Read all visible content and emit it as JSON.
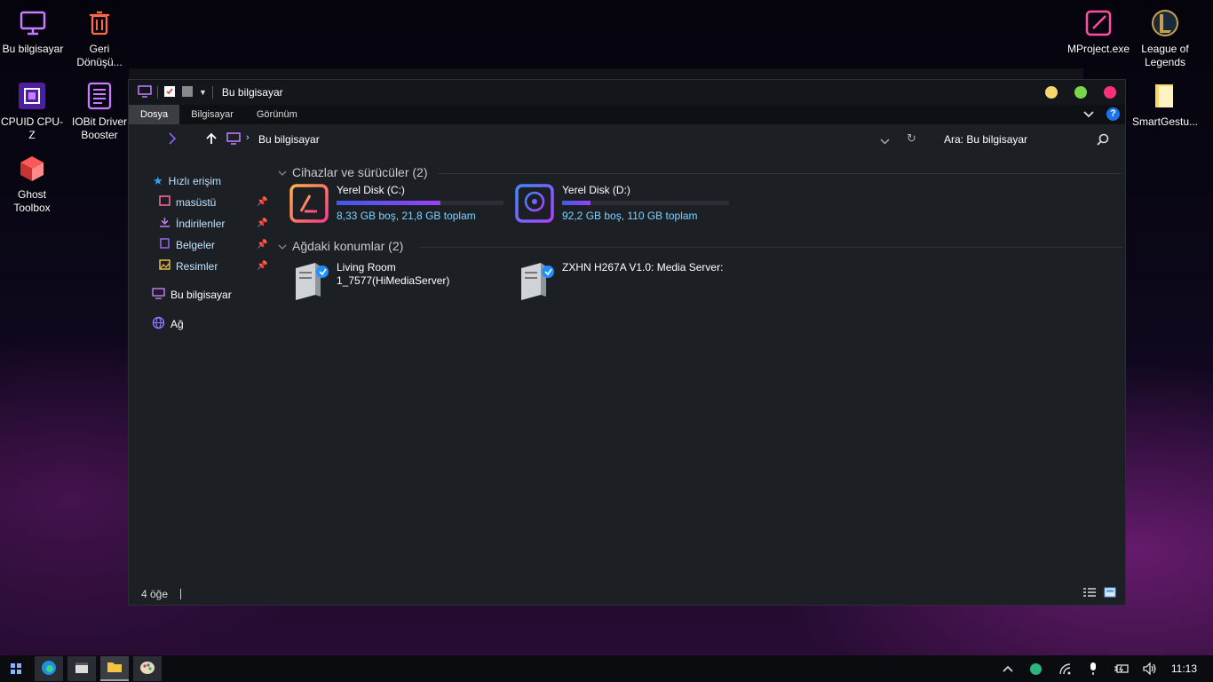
{
  "desktop": {
    "icons_left": [
      {
        "label": "Bu bilgisayar"
      },
      {
        "label": "Geri Dönüşü..."
      },
      {
        "label": "CPUID CPU-Z"
      },
      {
        "label": "IOBit Driver Booster"
      },
      {
        "label": "Ghost Toolbox"
      }
    ],
    "icons_right": [
      {
        "label": "MProject.exe"
      },
      {
        "label": "League of Legends"
      },
      {
        "label": "SmartGestu..."
      }
    ]
  },
  "window": {
    "title": "Bu bilgisayar",
    "controls_colors": {
      "minimize": "#f5d76e",
      "maximize": "#7bd64b",
      "close": "#ff2f7a"
    }
  },
  "ribbon": {
    "tabs": [
      {
        "label": "Dosya",
        "active": true
      },
      {
        "label": "Bilgisayar",
        "active": false
      },
      {
        "label": "Görünüm",
        "active": false
      }
    ],
    "help_label": "?"
  },
  "address": {
    "path": "Bu bilgisayar",
    "search_placeholder": "Ara: Bu bilgisayar"
  },
  "sidebar": {
    "quick_access": "Hızlı erişim",
    "pinned": [
      {
        "label": "masüstü"
      },
      {
        "label": "İndirilenler"
      },
      {
        "label": "Belgeler"
      },
      {
        "label": "Resimler"
      }
    ],
    "this_pc": "Bu bilgisayar",
    "network": "Ağ"
  },
  "content": {
    "devices_header": "Cihazlar ve sürücüler (2)",
    "drives": [
      {
        "name": "Yerel Disk (C:)",
        "info": "8,33 GB boş, 21,8 GB toplam",
        "used_fraction": 0.62
      },
      {
        "name": "Yerel Disk (D:)",
        "info": "92,2 GB boş, 110 GB toplam",
        "used_fraction": 0.17
      }
    ],
    "network_header": "Ağdaki konumlar (2)",
    "network_locations": [
      {
        "name_line1": "Living Room",
        "name_line2": "1_7577(HiMediaServer)"
      },
      {
        "name_line1": "ZXHN H267A V1.0: Media Server:",
        "name_line2": ""
      }
    ]
  },
  "status": {
    "item_count": "4 öğe"
  },
  "taskbar": {
    "clock": "11:13"
  },
  "colors": {
    "accent_blue": "#7fd3ff",
    "bar_gradient_start": "#3d5af1",
    "bar_gradient_end": "#9b40f5"
  }
}
